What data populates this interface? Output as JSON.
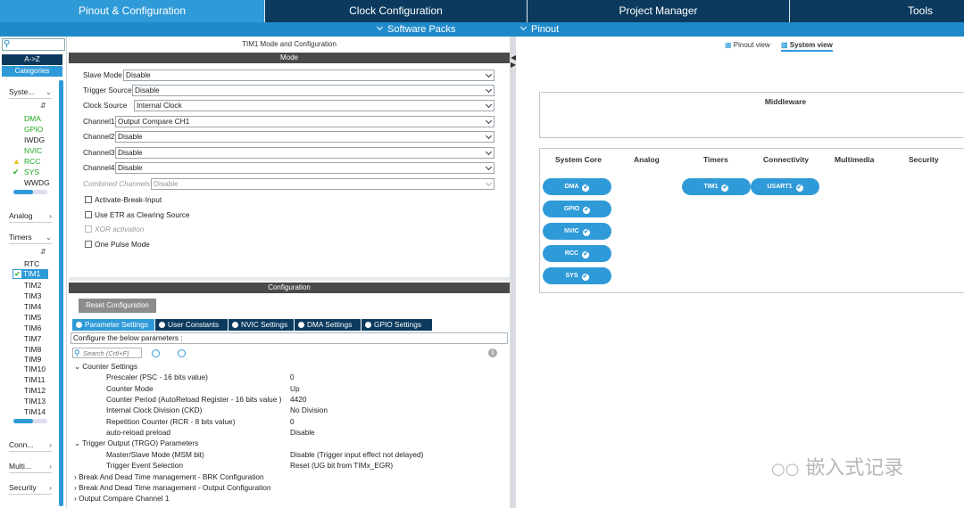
{
  "top_tabs": [
    "Pinout & Configuration",
    "Clock Configuration",
    "Project Manager",
    "Tools"
  ],
  "sub_bar": {
    "software_packs": "Software Packs",
    "pinout": "Pinout"
  },
  "categories": {
    "sort_az": "A->Z",
    "categories_btn": "Categories",
    "system_core": {
      "label": "Syste...",
      "items": [
        "DMA",
        "GPIO",
        "IWDG",
        "NVIC",
        "RCC",
        "SYS",
        "WWDG"
      ]
    },
    "analog": "Analog",
    "timers": {
      "label": "Timers",
      "items": [
        "RTC",
        "TIM1",
        "TIM2",
        "TIM3",
        "TIM4",
        "TIM5",
        "TIM6",
        "TIM7",
        "TIM8",
        "TIM9",
        "TIM10",
        "TIM11",
        "TIM12",
        "TIM13",
        "TIM14"
      ]
    },
    "connectivity": "Conn...",
    "multimedia": "Multi...",
    "security": "Security"
  },
  "mode": {
    "title": "TIM1 Mode and Configuration",
    "section": "Mode",
    "fields": [
      {
        "label": "Slave Mode",
        "value": "Disable"
      },
      {
        "label": "Trigger Source",
        "value": "Disable"
      },
      {
        "label": "Clock Source",
        "value": "Internal Clock"
      },
      {
        "label": "Channel1",
        "value": "Output Compare CH1"
      },
      {
        "label": "Channel2",
        "value": "Disable"
      },
      {
        "label": "Channel3",
        "value": "Disable"
      },
      {
        "label": "Channel4",
        "value": "Disable"
      },
      {
        "label": "Combined Channels",
        "value": "Disable"
      }
    ],
    "checkboxes": [
      "Activate-Break-Input",
      "Use ETR as Clearing Source",
      "XOR activation",
      "One Pulse Mode"
    ]
  },
  "configuration": {
    "section": "Configuration",
    "reset_button": "Reset Configuration",
    "tabs": [
      "Parameter Settings",
      "User Constants",
      "NVIC Settings",
      "DMA Settings",
      "GPIO Settings"
    ],
    "hint": "Configure the below parameters :",
    "search_placeholder": "Search (Crtl+F)",
    "counter_settings": {
      "title": "Counter Settings",
      "rows": [
        {
          "name": "Prescaler (PSC - 16 bits value)",
          "value": "0"
        },
        {
          "name": "Counter Mode",
          "value": "Up"
        },
        {
          "name": "Counter Period (AutoReload Register - 16 bits value )",
          "value": "4420"
        },
        {
          "name": "Internal Clock Division (CKD)",
          "value": "No Division"
        },
        {
          "name": "Repetition Counter (RCR - 8 bits value)",
          "value": "0"
        },
        {
          "name": "auto-reload preload",
          "value": "Disable"
        }
      ]
    },
    "trgo": {
      "title": "Trigger Output (TRGO) Parameters",
      "rows": [
        {
          "name": "Master/Slave Mode (MSM bit)",
          "value": "Disable (Trigger input effect not delayed)"
        },
        {
          "name": "Trigger Event Selection",
          "value": "Reset (UG bit from TIMx_EGR)"
        }
      ]
    },
    "collapsed": [
      "Break And Dead Time management - BRK Configuration",
      "Break And Dead Time management - Output Configuration",
      "Output Compare Channel 1"
    ]
  },
  "pinout": {
    "pinout_view": "Pinout view",
    "system_view": "System view",
    "middleware": "Middleware",
    "columns": [
      "System Core",
      "Analog",
      "Timers",
      "Connectivity",
      "Multimedia",
      "Security"
    ],
    "system_core_pills": [
      "DMA",
      "GPIO",
      "NVIC",
      "RCC",
      "SYS"
    ],
    "timers_pills": [
      "TIM1"
    ],
    "connectivity_pills": [
      "USART1"
    ]
  },
  "watermark": "嵌入式记录",
  "colors": {
    "dark_navy": "#0b3a5e",
    "accent_blue": "#2f9ad8",
    "green_ok": "#20a820",
    "warn_yellow": "#e8c21a"
  }
}
